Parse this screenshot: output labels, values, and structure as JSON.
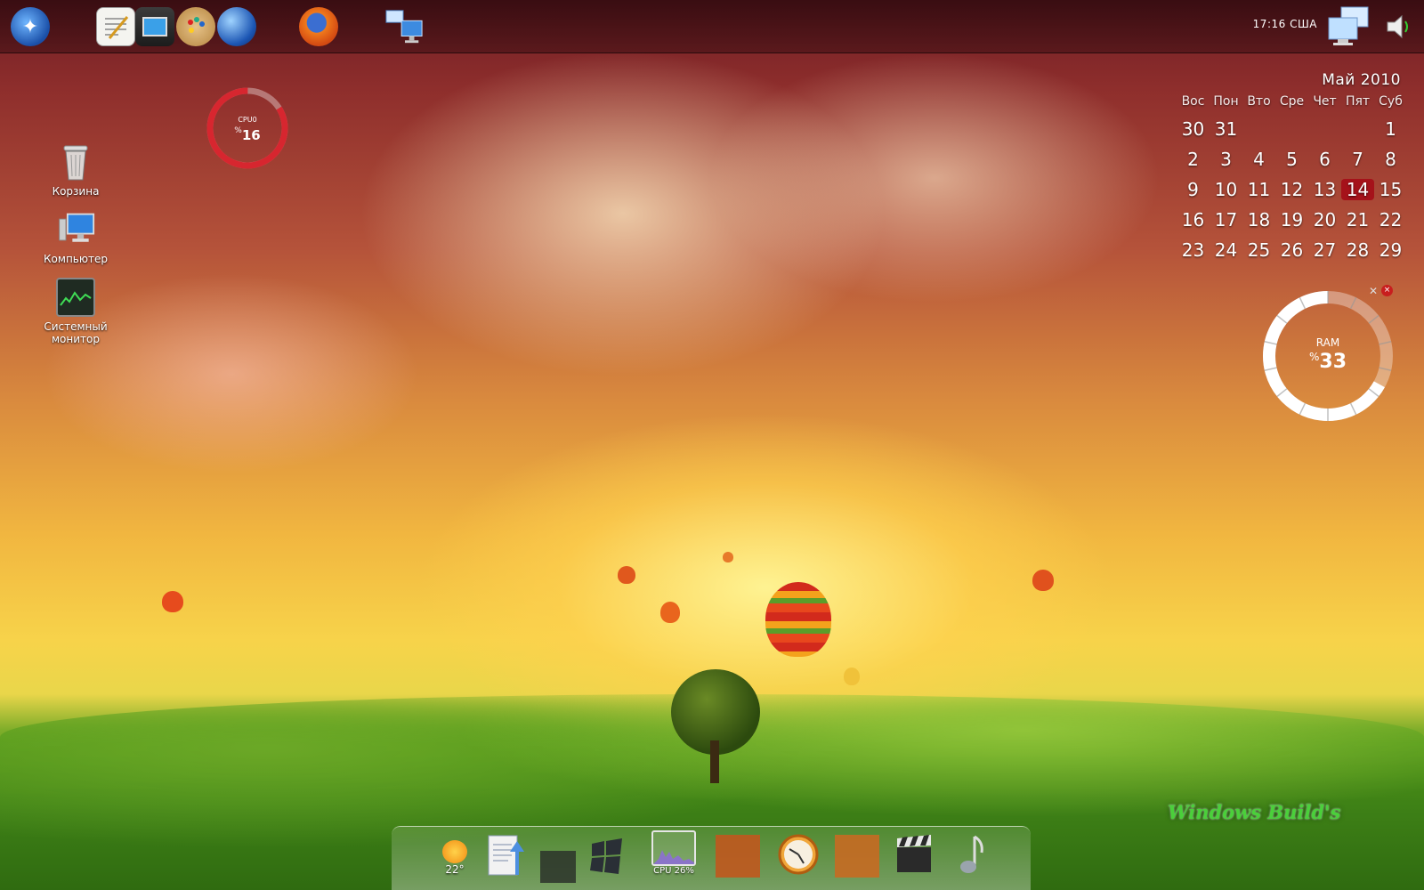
{
  "top_panel": {
    "clock": "17:16 США",
    "launchers": [
      {
        "name": "app-menu-icon"
      },
      {
        "name": "text-editor-icon"
      },
      {
        "name": "video-editor-icon"
      },
      {
        "name": "paint-icon"
      },
      {
        "name": "globe-browser-icon"
      },
      {
        "name": "firefox-icon"
      },
      {
        "name": "network-icon"
      }
    ],
    "tray": [
      {
        "name": "network-status-icon"
      },
      {
        "name": "volume-icon"
      }
    ]
  },
  "desktop_icons": [
    {
      "label": "Корзина",
      "icon": "trash-icon"
    },
    {
      "label": "Компьютер",
      "icon": "computer-icon"
    },
    {
      "label": "Системный монитор",
      "icon": "system-monitor-icon"
    }
  ],
  "calendar": {
    "title": "Май 2010",
    "weekdays": [
      "Вос",
      "Пон",
      "Вто",
      "Сре",
      "Чет",
      "Пят",
      "Суб"
    ],
    "today": "14",
    "rows": [
      [
        "30",
        "31",
        "",
        "",
        "",
        "",
        "1"
      ],
      [
        "2",
        "3",
        "4",
        "5",
        "6",
        "7",
        "8"
      ],
      [
        "9",
        "10",
        "11",
        "12",
        "13",
        "14",
        "15"
      ],
      [
        "16",
        "17",
        "18",
        "19",
        "20",
        "21",
        "22"
      ],
      [
        "23",
        "24",
        "25",
        "26",
        "27",
        "28",
        "29"
      ]
    ]
  },
  "cpu_gauge": {
    "label": "CPU0",
    "percent_sign": "%",
    "value": "16",
    "fraction": 0.16,
    "color": "#d7262f"
  },
  "ram_gauge": {
    "label": "RAM",
    "percent_sign": "%",
    "value": "33",
    "fraction": 0.33,
    "color": "#ffffff"
  },
  "dock": {
    "weather_temp": "22°",
    "cpu_label": "CPU 26%",
    "items": [
      "weather-icon",
      "document-upload-icon",
      "dark-tile",
      "windows-flag-icon",
      "cpu-graph",
      "orange-tile",
      "clock-icon",
      "orange-tile-2",
      "clapperboard-icon",
      "music-note-icon"
    ]
  },
  "brand": "Windows Build's",
  "colors": {
    "accent_red": "#a5121a",
    "brand_green": "#4ad03a"
  }
}
